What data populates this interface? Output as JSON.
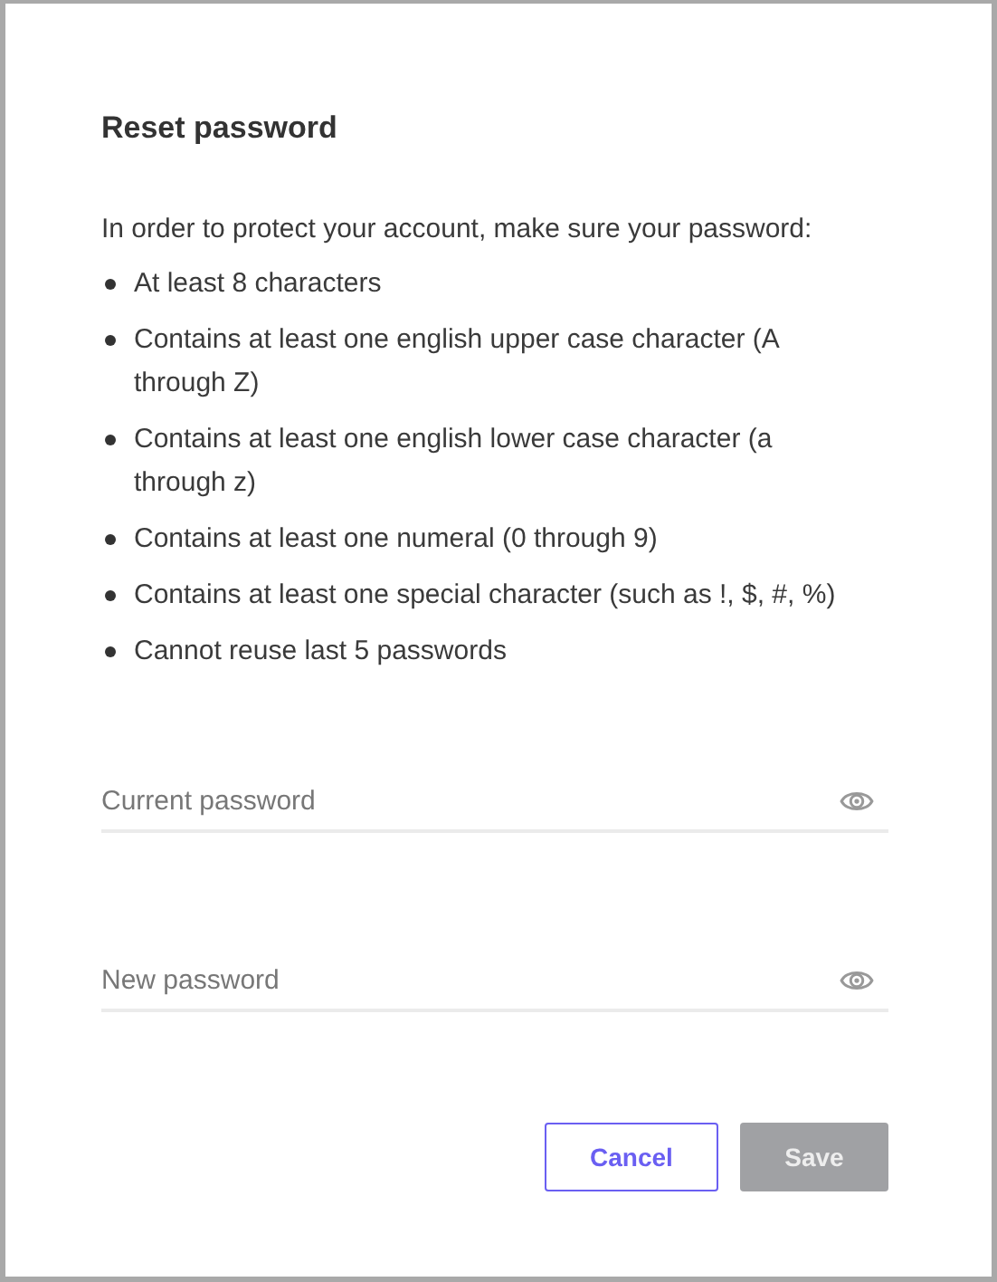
{
  "dialog": {
    "title": "Reset password",
    "intro": "In order to protect your account, make sure your password:",
    "requirements": [
      "At least 8 characters",
      "Contains at least one english upper case character (A through Z)",
      "Contains at least one english lower case character (a through z)",
      "Contains at least one numeral (0 through 9)",
      "Contains at least one special character (such as !, $, #, %)",
      "Cannot reuse last 5 passwords"
    ],
    "fields": [
      {
        "placeholder": "Current password"
      },
      {
        "placeholder": "New password"
      }
    ],
    "buttons": [
      {
        "label": "Cancel",
        "kind": "secondary",
        "disabled": false
      },
      {
        "label": "Save",
        "kind": "primary",
        "disabled": true
      }
    ]
  }
}
